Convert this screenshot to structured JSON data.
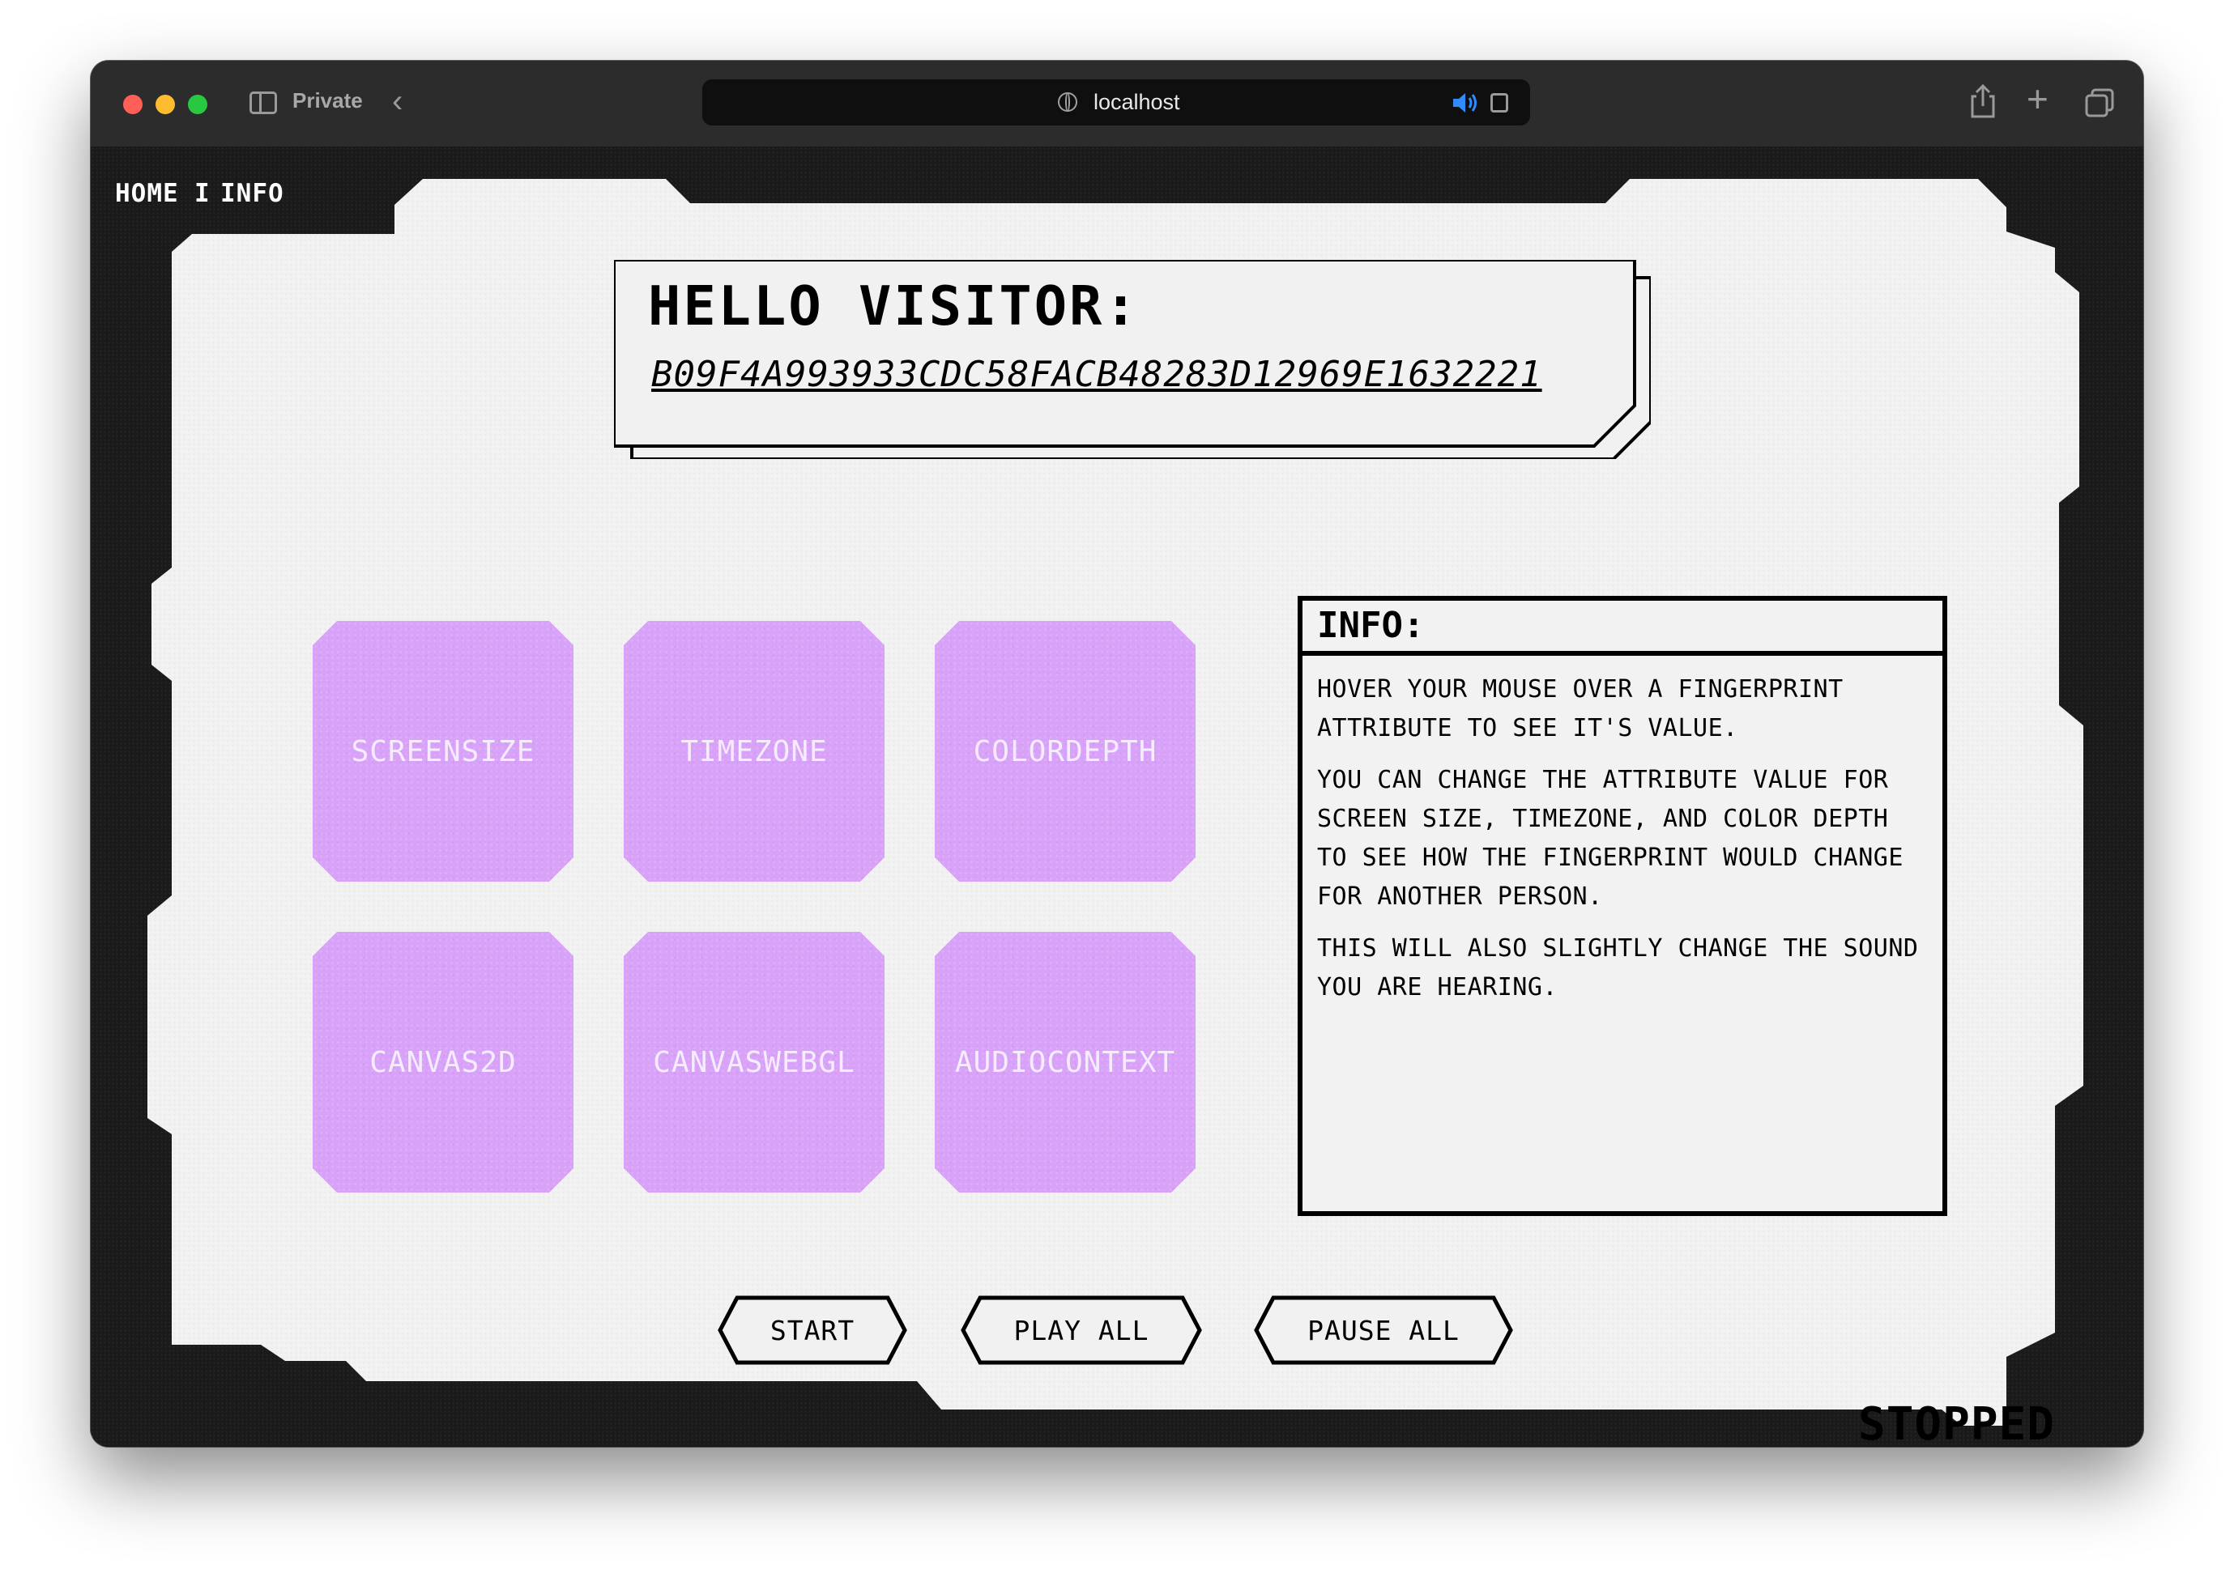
{
  "browser": {
    "private_label": "Private",
    "back_glyph": "‹",
    "url": "localhost",
    "new_tab_glyph": "+",
    "icons": [
      "sidebar-icon",
      "globe-icon",
      "speaker-icon",
      "reader-icon",
      "share-icon",
      "plus-icon",
      "tabs-icon"
    ]
  },
  "nav": {
    "home": "HOME",
    "separator": "I",
    "info": "INFO"
  },
  "greeting": {
    "title": "HELLO VISITOR:",
    "visitor_id": "B09F4A993933CDC58FACB48283D12969E1632221"
  },
  "tiles": [
    {
      "label": "SCREENSIZE"
    },
    {
      "label": "TIMEZONE"
    },
    {
      "label": "COLORDEPTH"
    },
    {
      "label": "CANVAS2D"
    },
    {
      "label": "CANVASWEBGL"
    },
    {
      "label": "AUDIOCONTEXT"
    }
  ],
  "info": {
    "title": "INFO:",
    "paragraphs": [
      "HOVER YOUR MOUSE OVER A FINGERPRINT ATTRIBUTE TO SEE IT'S VALUE.",
      "YOU CAN CHANGE THE ATTRIBUTE VALUE FOR SCREEN SIZE, TIMEZONE, AND COLOR DEPTH TO SEE HOW THE FINGERPRINT WOULD CHANGE FOR ANOTHER PERSON.",
      "THIS WILL ALSO SLIGHTLY CHANGE THE SOUND YOU ARE HEARING."
    ]
  },
  "controls": {
    "start": "START",
    "play_all": "PLAY ALL",
    "pause_all": "PAUSE ALL"
  },
  "status": "STOPPED",
  "colors": {
    "tile": "#d8a2f8",
    "panel": "#f2f2f2",
    "frame": "#1a1a1a"
  }
}
